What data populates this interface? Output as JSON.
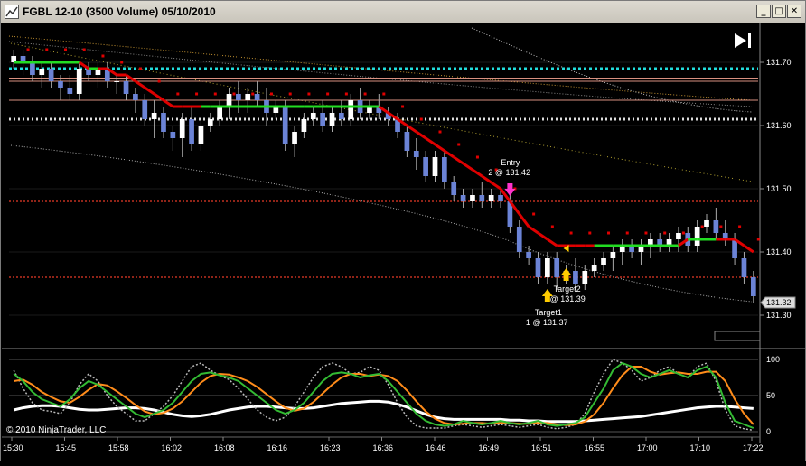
{
  "window": {
    "title": "FGBL 12-10 (3500 Volume)  05/10/2010",
    "min_glyph": "_",
    "max_glyph": "□",
    "close_glyph": "✕"
  },
  "toolbar": {
    "play_icon": "skip-forward-icon"
  },
  "copyright": "© 2010 NinjaTrader, LLC",
  "annotations": {
    "entry_line1": "Entry",
    "entry_line2": "2 @ 131.42",
    "target2_line1": "Target2",
    "target2_line2": "@ 131.39",
    "target1_line1": "Target1",
    "target1_line2": "1 @ 131.37"
  },
  "colors": {
    "bull_candle": "#ffffff",
    "bear_candle": "#6b83d6",
    "ma_red": "#e00000",
    "ma_green": "#22dd22",
    "cyan_level": "#22dddd",
    "stoch_orange": "#ff8c1a",
    "stoch_green": "#33bb33",
    "white_line": "#ffffff",
    "entry_arrow": "#ff33cc",
    "target_arrow": "#ffcc00"
  },
  "chart_data": {
    "type": "candlestick",
    "instrument": "FGBL 12-10",
    "bar_type": "3500 Volume",
    "date": "05/10/2010",
    "price_ticks": [
      "131.70",
      "131.60",
      "131.50",
      "131.40",
      "131.30"
    ],
    "last_price": "131.32",
    "time_ticks": [
      "15:30",
      "15:45",
      "15:58",
      "16:02",
      "16:08",
      "16:16",
      "16:23",
      "16:36",
      "16:46",
      "16:49",
      "16:51",
      "16:55",
      "17:00",
      "17:10",
      "17:22"
    ],
    "indicator_ticks": [
      "100",
      "50",
      "0"
    ],
    "ylim": [
      131.25,
      131.75
    ],
    "candles": [
      [
        131.7,
        131.72,
        131.69,
        131.71
      ],
      [
        131.71,
        131.72,
        131.68,
        131.7
      ],
      [
        131.7,
        131.71,
        131.67,
        131.68
      ],
      [
        131.68,
        131.7,
        131.66,
        131.69
      ],
      [
        131.69,
        131.7,
        131.66,
        131.67
      ],
      [
        131.67,
        131.68,
        131.64,
        131.66
      ],
      [
        131.66,
        131.68,
        131.64,
        131.65
      ],
      [
        131.65,
        131.7,
        131.64,
        131.69
      ],
      [
        131.69,
        131.7,
        131.67,
        131.68
      ],
      [
        131.68,
        131.7,
        131.66,
        131.69
      ],
      [
        131.69,
        131.7,
        131.66,
        131.67
      ],
      [
        131.67,
        131.68,
        131.65,
        131.67
      ],
      [
        131.67,
        131.68,
        131.64,
        131.65
      ],
      [
        131.65,
        131.66,
        131.62,
        131.64
      ],
      [
        131.64,
        131.65,
        131.6,
        131.61
      ],
      [
        131.61,
        131.64,
        131.58,
        131.62
      ],
      [
        131.62,
        131.63,
        131.58,
        131.59
      ],
      [
        131.59,
        131.6,
        131.56,
        131.58
      ],
      [
        131.58,
        131.62,
        131.55,
        131.61
      ],
      [
        131.61,
        131.63,
        131.56,
        131.57
      ],
      [
        131.57,
        131.61,
        131.56,
        131.6
      ],
      [
        131.6,
        131.62,
        131.59,
        131.61
      ],
      [
        131.61,
        131.64,
        131.6,
        131.63
      ],
      [
        131.63,
        131.66,
        131.61,
        131.65
      ],
      [
        131.65,
        131.67,
        131.62,
        131.64
      ],
      [
        131.64,
        131.66,
        131.62,
        131.65
      ],
      [
        131.65,
        131.67,
        131.63,
        131.64
      ],
      [
        131.64,
        131.66,
        131.6,
        131.62
      ],
      [
        131.62,
        131.64,
        131.61,
        131.63
      ],
      [
        131.63,
        131.64,
        131.56,
        131.57
      ],
      [
        131.57,
        131.6,
        131.55,
        131.59
      ],
      [
        131.59,
        131.62,
        131.58,
        131.61
      ],
      [
        131.61,
        131.63,
        131.6,
        131.62
      ],
      [
        131.62,
        131.64,
        131.59,
        131.6
      ],
      [
        131.6,
        131.63,
        131.59,
        131.62
      ],
      [
        131.62,
        131.64,
        131.6,
        131.61
      ],
      [
        131.61,
        131.65,
        131.6,
        131.64
      ],
      [
        131.64,
        131.66,
        131.61,
        131.62
      ],
      [
        131.62,
        131.64,
        131.61,
        131.63
      ],
      [
        131.63,
        131.65,
        131.61,
        131.62
      ],
      [
        131.62,
        131.63,
        131.6,
        131.61
      ],
      [
        131.61,
        131.62,
        131.58,
        131.59
      ],
      [
        131.59,
        131.6,
        131.55,
        131.56
      ],
      [
        131.56,
        131.58,
        131.53,
        131.55
      ],
      [
        131.55,
        131.56,
        131.51,
        131.52
      ],
      [
        131.52,
        131.56,
        131.51,
        131.55
      ],
      [
        131.55,
        131.56,
        131.5,
        131.51
      ],
      [
        131.51,
        131.52,
        131.48,
        131.49
      ],
      [
        131.49,
        131.5,
        131.47,
        131.48
      ],
      [
        131.48,
        131.5,
        131.47,
        131.49
      ],
      [
        131.49,
        131.51,
        131.47,
        131.48
      ],
      [
        131.48,
        131.5,
        131.47,
        131.49
      ],
      [
        131.49,
        131.5,
        131.47,
        131.48
      ],
      [
        131.48,
        131.49,
        131.43,
        131.44
      ],
      [
        131.44,
        131.45,
        131.39,
        131.4
      ],
      [
        131.4,
        131.41,
        131.38,
        131.39
      ],
      [
        131.39,
        131.4,
        131.35,
        131.36
      ],
      [
        131.36,
        131.4,
        131.35,
        131.39
      ],
      [
        131.39,
        131.4,
        131.34,
        131.36
      ],
      [
        131.36,
        131.38,
        131.35,
        131.37
      ],
      [
        131.37,
        131.39,
        131.34,
        131.35
      ],
      [
        131.35,
        131.38,
        131.34,
        131.37
      ],
      [
        131.37,
        131.39,
        131.36,
        131.38
      ],
      [
        131.38,
        131.4,
        131.37,
        131.39
      ],
      [
        131.39,
        131.41,
        131.37,
        131.4
      ],
      [
        131.4,
        131.42,
        131.38,
        131.41
      ],
      [
        131.41,
        131.42,
        131.39,
        131.4
      ],
      [
        131.4,
        131.42,
        131.38,
        131.41
      ],
      [
        131.41,
        131.43,
        131.39,
        131.42
      ],
      [
        131.42,
        131.43,
        131.4,
        131.41
      ],
      [
        131.41,
        131.43,
        131.4,
        131.42
      ],
      [
        131.42,
        131.44,
        131.4,
        131.43
      ],
      [
        131.43,
        131.44,
        131.4,
        131.41
      ],
      [
        131.41,
        131.45,
        131.4,
        131.44
      ],
      [
        131.44,
        131.46,
        131.43,
        131.45
      ],
      [
        131.45,
        131.47,
        131.42,
        131.43
      ],
      [
        131.43,
        131.45,
        131.41,
        131.42
      ],
      [
        131.42,
        131.43,
        131.38,
        131.39
      ],
      [
        131.39,
        131.4,
        131.35,
        131.36
      ],
      [
        131.36,
        131.37,
        131.32,
        131.33
      ]
    ],
    "levels": {
      "cyan_dotted": 131.69,
      "salmon_lines": [
        131.675,
        131.67,
        131.64
      ],
      "white_dotted": 131.61,
      "red_dotted": [
        131.48,
        131.36
      ]
    },
    "ma_values": [
      131.7,
      131.7,
      131.7,
      131.7,
      131.7,
      131.7,
      131.7,
      131.7,
      131.69,
      131.69,
      131.69,
      131.68,
      131.68,
      131.67,
      131.66,
      131.65,
      131.64,
      131.63,
      131.63,
      131.63,
      131.63,
      131.63,
      131.63,
      131.63,
      131.63,
      131.63,
      131.63,
      131.63,
      131.63,
      131.63,
      131.63,
      131.63,
      131.63,
      131.63,
      131.63,
      131.63,
      131.63,
      131.63,
      131.63,
      131.63,
      131.62,
      131.61,
      131.6,
      131.59,
      131.58,
      131.57,
      131.56,
      131.55,
      131.54,
      131.53,
      131.52,
      131.51,
      131.5,
      131.48,
      131.46,
      131.44,
      131.43,
      131.42,
      131.41,
      131.41,
      131.41,
      131.41,
      131.41,
      131.41,
      131.41,
      131.41,
      131.41,
      131.41,
      131.41,
      131.41,
      131.41,
      131.41,
      131.42,
      131.42,
      131.42,
      131.42,
      131.42,
      131.42,
      131.41,
      131.4
    ],
    "stoch_fast": [
      80,
      70,
      55,
      45,
      40,
      35,
      45,
      60,
      70,
      65,
      55,
      45,
      35,
      25,
      20,
      25,
      30,
      40,
      55,
      70,
      80,
      82,
      78,
      75,
      70,
      60,
      50,
      40,
      30,
      25,
      30,
      40,
      55,
      70,
      80,
      82,
      80,
      75,
      78,
      80,
      70,
      55,
      40,
      25,
      15,
      10,
      8,
      10,
      15,
      12,
      10,
      12,
      15,
      12,
      10,
      12,
      15,
      10,
      8,
      10,
      12,
      20,
      40,
      60,
      85,
      95,
      90,
      80,
      75,
      80,
      85,
      80,
      75,
      85,
      90,
      75,
      40,
      15,
      10,
      5
    ],
    "stoch_slow": [
      70,
      72,
      65,
      55,
      48,
      42,
      40,
      48,
      58,
      66,
      64,
      56,
      47,
      37,
      28,
      24,
      26,
      32,
      42,
      55,
      68,
      77,
      80,
      79,
      75,
      70,
      62,
      52,
      42,
      33,
      29,
      32,
      41,
      53,
      65,
      75,
      80,
      80,
      77,
      79,
      77,
      70,
      57,
      42,
      28,
      18,
      12,
      10,
      11,
      12,
      12,
      11,
      12,
      12,
      11,
      11,
      12,
      12,
      10,
      9,
      10,
      14,
      24,
      40,
      60,
      78,
      90,
      90,
      83,
      79,
      81,
      82,
      80,
      80,
      83,
      83,
      70,
      45,
      25,
      10
    ],
    "white_osc": [
      30,
      33,
      35,
      36,
      36,
      35,
      33,
      31,
      30,
      30,
      31,
      32,
      33,
      33,
      32,
      30,
      27,
      24,
      22,
      21,
      22,
      24,
      27,
      30,
      32,
      34,
      35,
      35,
      34,
      33,
      32,
      32,
      33,
      35,
      37,
      39,
      40,
      41,
      42,
      42,
      41,
      38,
      34,
      29,
      24,
      20,
      18,
      17,
      17,
      17,
      17,
      17,
      17,
      16,
      16,
      15,
      15,
      14,
      14,
      14,
      14,
      15,
      16,
      17,
      18,
      19,
      20,
      21,
      23,
      25,
      27,
      29,
      31,
      33,
      34,
      35,
      35,
      34,
      33,
      32
    ],
    "dotted_osc": [
      85,
      60,
      40,
      30,
      28,
      25,
      40,
      65,
      80,
      70,
      50,
      35,
      25,
      15,
      15,
      25,
      35,
      50,
      70,
      90,
      95,
      85,
      78,
      72,
      60,
      45,
      30,
      20,
      15,
      20,
      35,
      55,
      75,
      90,
      95,
      90,
      80,
      82,
      90,
      85,
      65,
      40,
      20,
      8,
      5,
      5,
      5,
      8,
      10,
      8,
      6,
      8,
      10,
      8,
      6,
      8,
      10,
      6,
      4,
      6,
      10,
      25,
      55,
      80,
      100,
      95,
      85,
      70,
      75,
      85,
      90,
      80,
      75,
      90,
      95,
      70,
      30,
      8,
      4,
      2
    ]
  }
}
